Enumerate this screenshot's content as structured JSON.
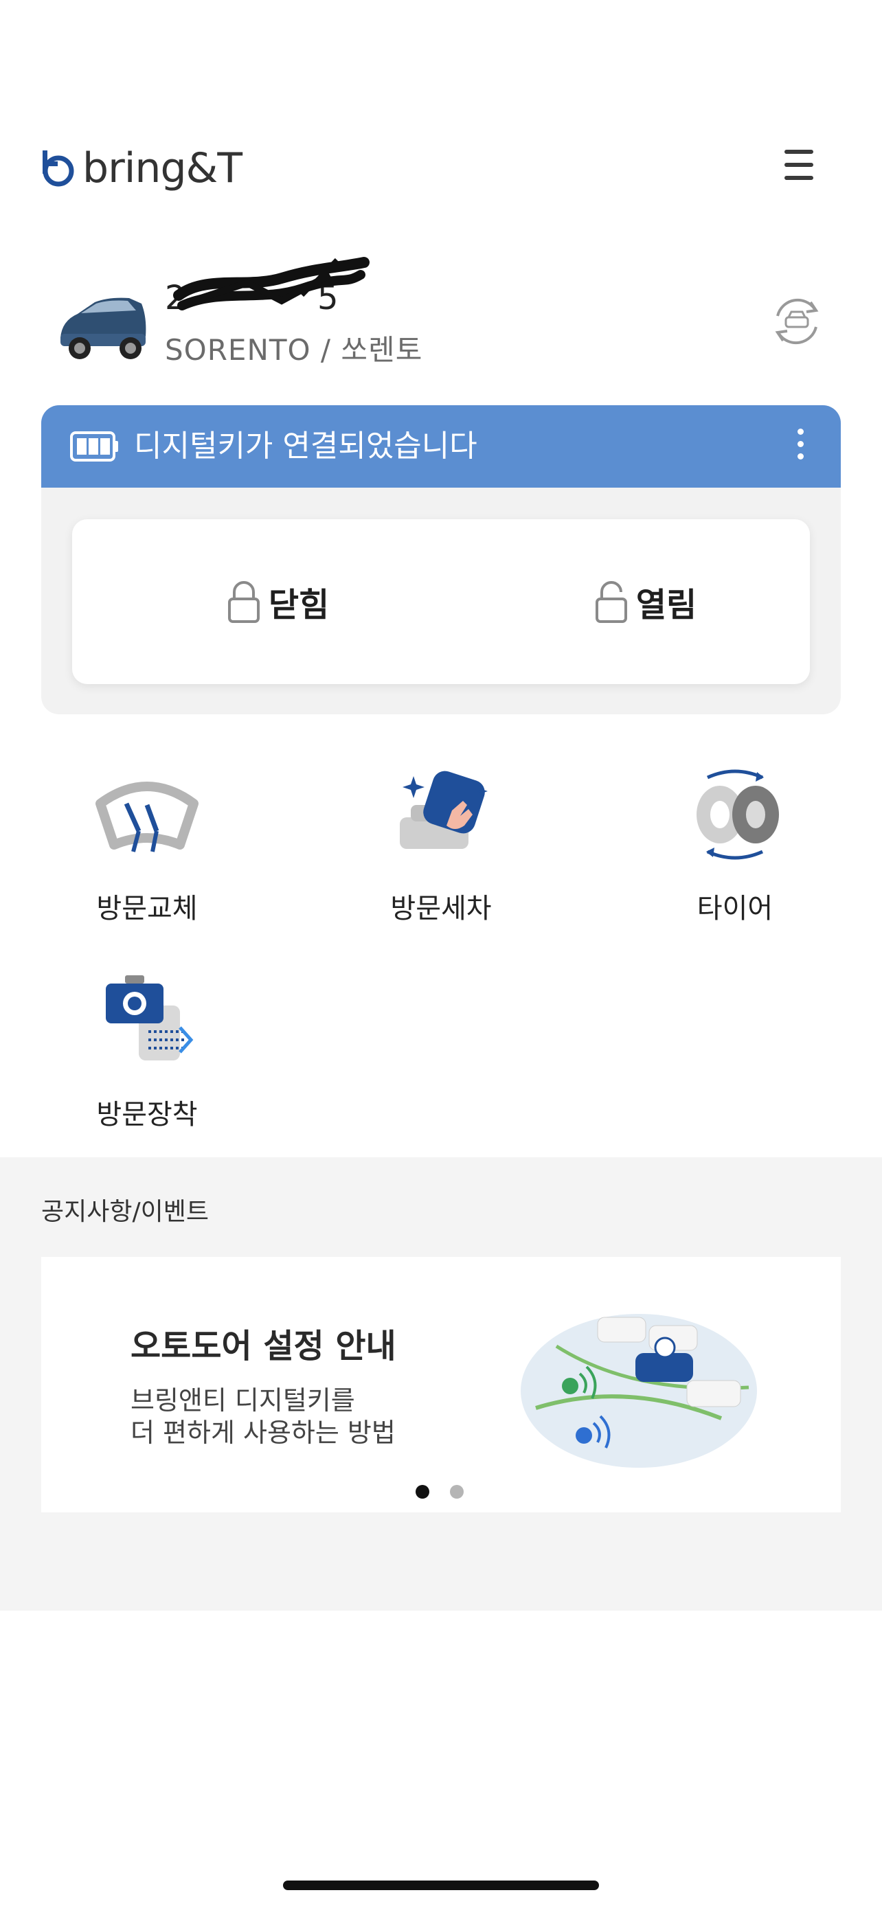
{
  "header": {
    "logo_text": "bring&T",
    "menu_icon": "hamburger-menu-icon"
  },
  "vehicle": {
    "plate_visible": "2",
    "plate_tail": "5",
    "model": "SORENTO / 쏘렌토",
    "swap_icon": "car-swap-icon"
  },
  "digital_key": {
    "status": "디지털키가 연결되었습니다",
    "battery_icon": "battery-icon",
    "more_icon": "more-vertical-icon",
    "lock_label": "닫힘",
    "unlock_label": "열림",
    "header_color": "#5b8ed1"
  },
  "services": [
    {
      "label": "방문교체",
      "icon": "wiper-icon"
    },
    {
      "label": "방문세차",
      "icon": "car-wash-icon"
    },
    {
      "label": "타이어",
      "icon": "tire-icon"
    },
    {
      "label": "방문장착",
      "icon": "dashcam-icon"
    }
  ],
  "notices": {
    "section_title": "공지사항/이벤트",
    "banner": {
      "headline": "오토도어 설정 안내",
      "line1": "브링앤티 디지털키를",
      "line2": "더 편하게 사용하는 방법"
    },
    "pagination": {
      "current": 1,
      "total": 2
    }
  },
  "colors": {
    "accent_blue": "#5b8ed1",
    "icon_blue": "#1f4f9a",
    "section_bg": "#f4f4f4"
  }
}
